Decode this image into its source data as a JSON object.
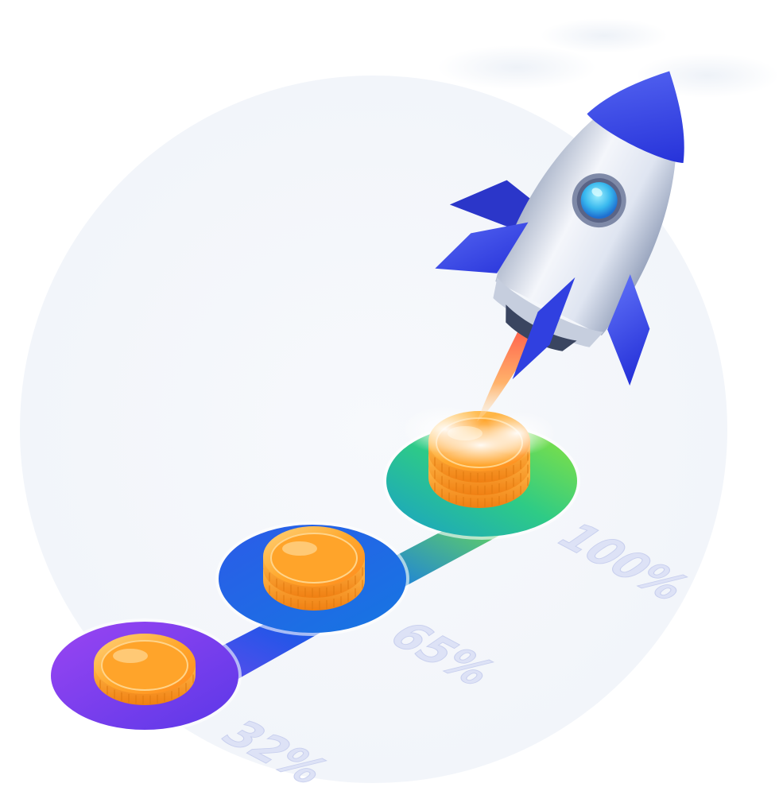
{
  "illustration": {
    "milestones": [
      {
        "label": "32%",
        "coins": 1,
        "color": "#7b4df0"
      },
      {
        "label": "65%",
        "coins": 2,
        "color": "#1f63e6"
      },
      {
        "label": "100%",
        "coins": 3,
        "color": "#5bd85a"
      }
    ],
    "rocket": {
      "body_color": "#e8edf7",
      "fin_color": "#3545e6",
      "window_color": "#3fc2ee",
      "flame_color": "#ff8b5e"
    },
    "coin_color": "#ffb03a",
    "backdrop_color": "#f5f7fb"
  }
}
